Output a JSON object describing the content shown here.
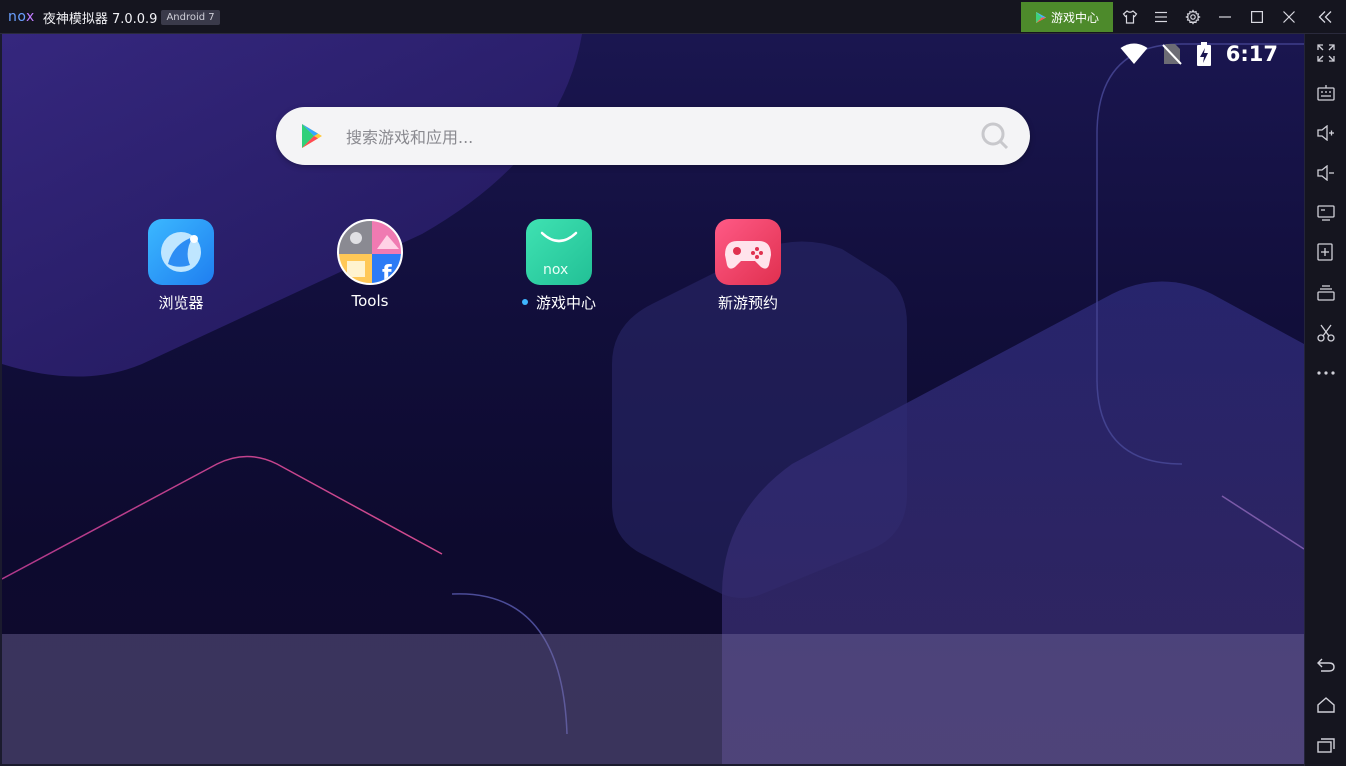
{
  "window": {
    "logo_text": [
      "no",
      "x"
    ],
    "title": "夜神模拟器 7.0.0.9",
    "android_badge": "Android 7",
    "game_center_label": "游戏中心"
  },
  "titlebar_icons": [
    "shirt-icon",
    "menu-icon",
    "gear-icon",
    "minimize-icon",
    "maximize-icon",
    "close-icon",
    "collapse-left-icon"
  ],
  "sidebar_icons": [
    "fullscreen-icon",
    "keyboard-icon",
    "volume-up-icon",
    "volume-down-icon",
    "screen-icon",
    "apk-install-icon",
    "multi-instance-icon",
    "scissors-icon",
    "more-icon",
    "back-icon",
    "home-icon",
    "recents-icon"
  ],
  "status_bar": {
    "time": "6:17",
    "icons": [
      "wifi-icon",
      "no-sim-icon",
      "battery-charging-icon"
    ]
  },
  "search": {
    "placeholder": "搜索游戏和应用..."
  },
  "apps": [
    {
      "label": "浏览器",
      "icon": "browser-icon",
      "color": "#2f9bff",
      "new": false
    },
    {
      "label": "Tools",
      "icon": "tools-folder-icon",
      "color": "#e8e8ee",
      "new": false
    },
    {
      "label": "游戏中心",
      "icon": "game-center-icon",
      "color": "#34d6a8",
      "new": true
    },
    {
      "label": "新游预约",
      "icon": "game-reserve-icon",
      "color": "#ef3e6a",
      "new": false
    }
  ],
  "colors": {
    "accent_green": "#4d8a2b",
    "screen_bg": "#110e3a",
    "new_dot": "#3fb6ff"
  }
}
